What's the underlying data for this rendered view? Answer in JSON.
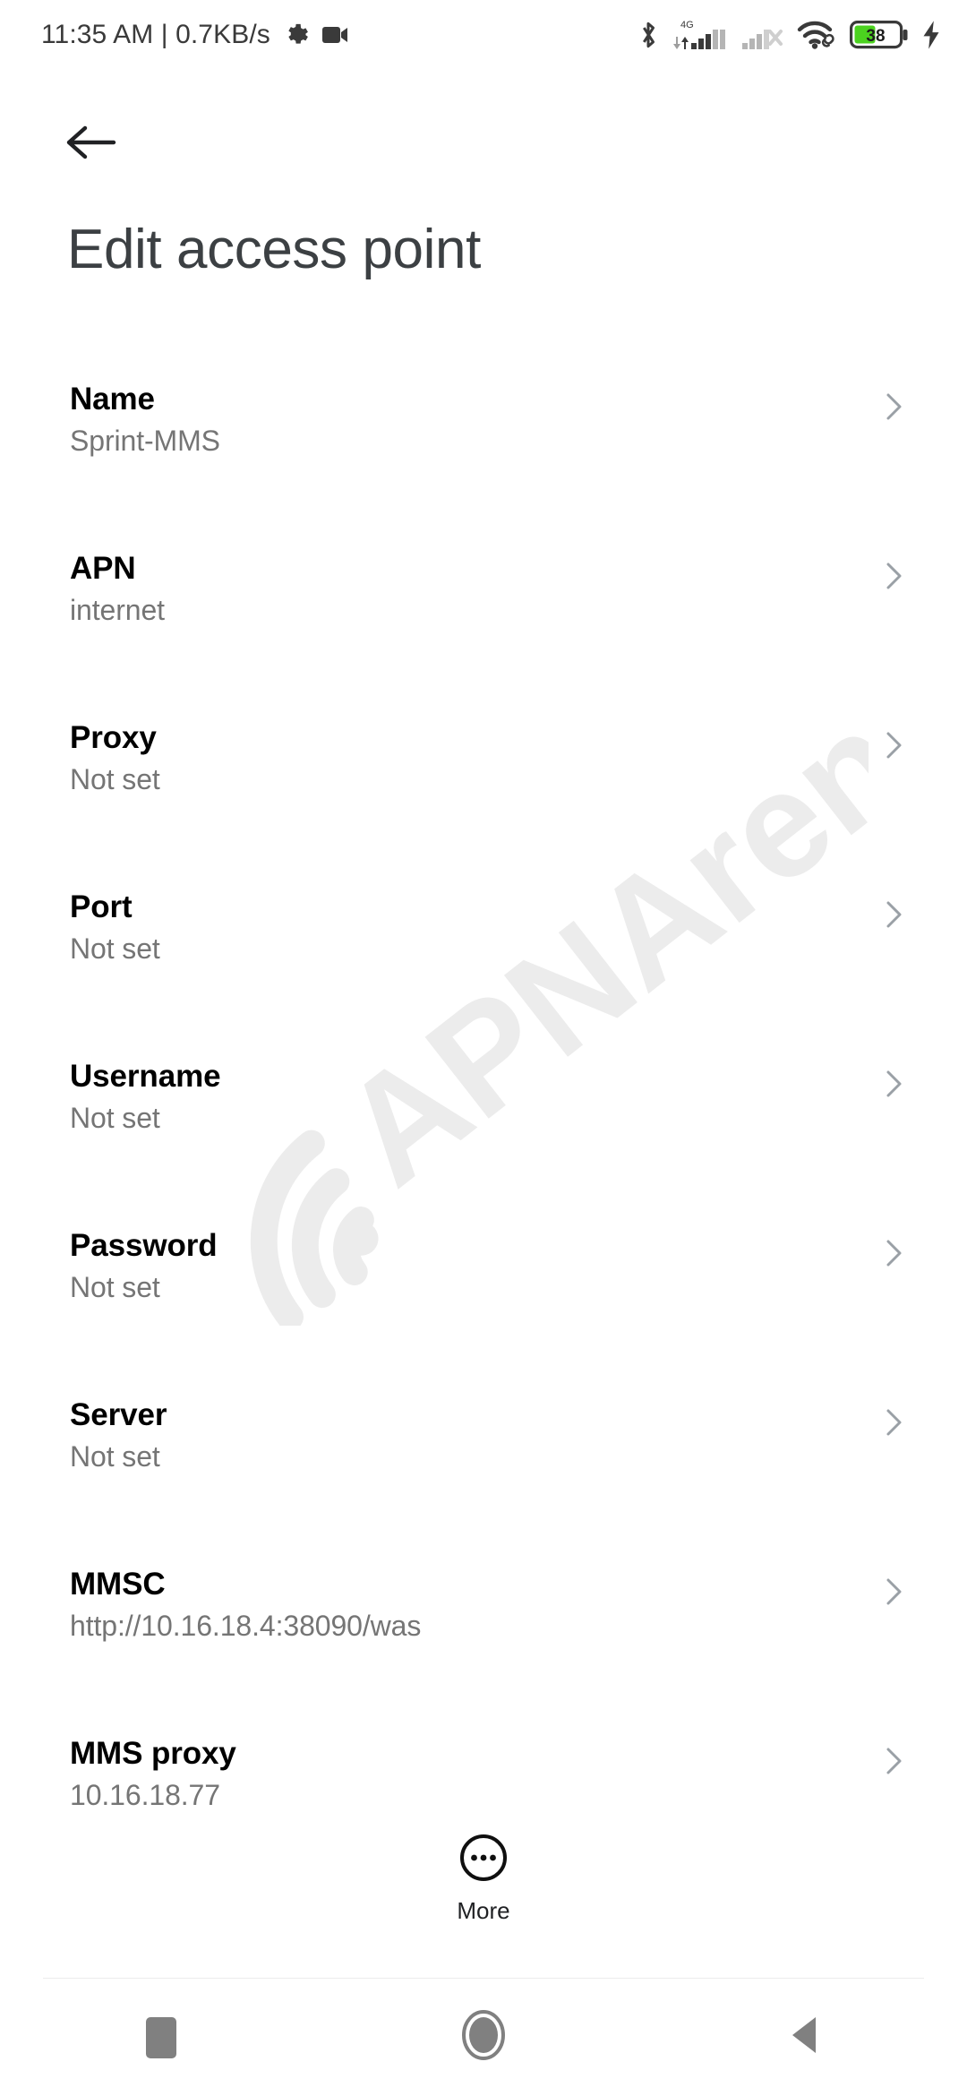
{
  "status_bar": {
    "clock": "11:35 AM | 0.7KB/s",
    "icons": [
      {
        "name": "settings-gear-icon",
        "label": "gear"
      },
      {
        "name": "screen-recorder-icon",
        "label": "video-camera"
      },
      {
        "name": "bluetooth-icon",
        "label": "bluetooth"
      },
      {
        "name": "mobile-signal-4g-icon",
        "label": "4G"
      },
      {
        "name": "mobile-signal-sim2-icon",
        "label": "no-service"
      },
      {
        "name": "wifi-icon",
        "label": "wifi-connected"
      },
      {
        "name": "battery-icon",
        "label": "38"
      },
      {
        "name": "charging-bolt-icon",
        "label": "charging"
      }
    ],
    "network_type": "4G",
    "battery_level": "38",
    "battery_color": "#4bd21f"
  },
  "appbar": {
    "back_label": "Back",
    "title": "Edit access point"
  },
  "watermark": {
    "text": "APNArena",
    "color": "#ececec"
  },
  "settings": {
    "rows": [
      {
        "label": "Name",
        "value": "Sprint-MMS"
      },
      {
        "label": "APN",
        "value": "internet"
      },
      {
        "label": "Proxy",
        "value": "Not set"
      },
      {
        "label": "Port",
        "value": "Not set"
      },
      {
        "label": "Username",
        "value": "Not set"
      },
      {
        "label": "Password",
        "value": "Not set"
      },
      {
        "label": "Server",
        "value": "Not set"
      },
      {
        "label": "MMSC",
        "value": "http://10.16.18.4:38090/was"
      },
      {
        "label": "MMS proxy",
        "value": "10.16.18.77"
      }
    ]
  },
  "more_button": {
    "label": "More",
    "icon": "more-horizontal-circle-icon"
  },
  "nav_bar": {
    "recents_label": "Recents",
    "home_label": "Home",
    "back_label": "Back"
  }
}
